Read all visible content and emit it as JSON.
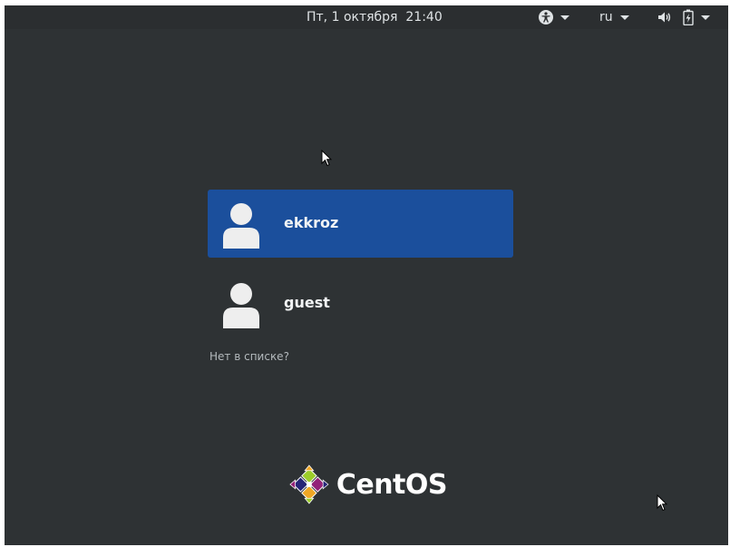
{
  "topbar": {
    "clock": "Пт, 1 октября  21:40",
    "language": "ru",
    "icons": {
      "accessibility": "accessibility-icon",
      "volume": "volume-icon",
      "battery": "battery-charging-icon"
    }
  },
  "users": [
    {
      "name": "ekkroz",
      "selected": true
    },
    {
      "name": "guest",
      "selected": false
    }
  ],
  "not_listed_label": "Нет в списке?",
  "logo": {
    "text": "CentOS",
    "colors": {
      "green": "#9ccd2a",
      "orange": "#efa724",
      "blue": "#262577",
      "purple": "#932279"
    }
  },
  "colors": {
    "background": "#2e3234",
    "selection": "#1b4f9c",
    "text": "#f2f4f5"
  }
}
